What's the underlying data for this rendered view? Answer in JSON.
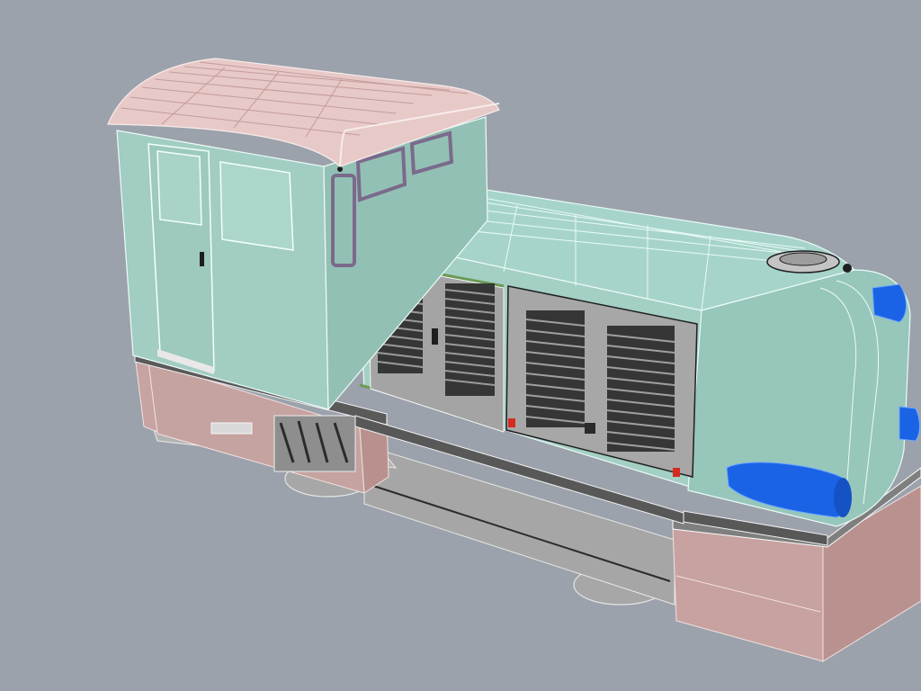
{
  "viewport": {
    "background": "#9ba2ab",
    "object": "locomotive-model"
  },
  "colors": {
    "wire_light": "#e9fbf6",
    "body": "#9fcbc0",
    "body_dark": "#7fb3a8",
    "roof": "#e7c9c8",
    "frame": "#c9a6a3",
    "frame_dark": "#a98583",
    "grey": "#a8a8a8",
    "grey_dark": "#8d8d8d",
    "black": "#1c1c1c",
    "blue": "#1b63e6",
    "blue_light": "#4a8cf2",
    "green_stripe": "#6b9a54",
    "cyan_patch": "#35d5c8",
    "red": "#d42a1f",
    "purple": "#7a6a8c"
  }
}
